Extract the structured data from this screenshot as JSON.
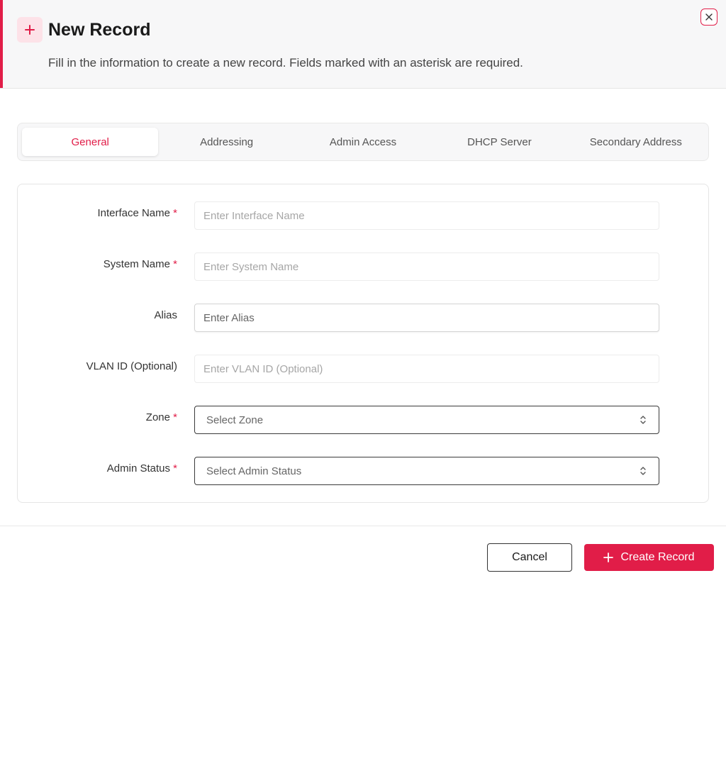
{
  "header": {
    "title": "New Record",
    "description": "Fill in the information to create a new record. Fields marked with an asterisk are required.",
    "icon": "plus-icon",
    "close_icon": "close-icon",
    "accent_color": "#e11d48"
  },
  "tabs": [
    {
      "label": "General",
      "active": true
    },
    {
      "label": "Addressing",
      "active": false
    },
    {
      "label": "Admin Access",
      "active": false
    },
    {
      "label": "DHCP Server",
      "active": false
    },
    {
      "label": "Secondary Address",
      "active": false
    }
  ],
  "form": {
    "interface_name": {
      "label": "Interface Name",
      "required_mark": "*",
      "placeholder": "Enter Interface Name",
      "value": ""
    },
    "system_name": {
      "label": "System Name",
      "required_mark": "*",
      "placeholder": "Enter System Name",
      "value": ""
    },
    "alias": {
      "label": "Alias",
      "placeholder": "Enter Alias",
      "value": ""
    },
    "vlan_id": {
      "label": "VLAN ID (Optional)",
      "placeholder": "Enter VLAN ID (Optional)",
      "value": ""
    },
    "zone": {
      "label": "Zone",
      "required_mark": "*",
      "selected": "Select Zone",
      "icon": "chevron-up-down-icon"
    },
    "admin_status": {
      "label": "Admin Status",
      "required_mark": "*",
      "selected": "Select Admin Status",
      "icon": "chevron-up-down-icon"
    }
  },
  "footer": {
    "cancel_label": "Cancel",
    "create_label": "Create Record",
    "create_icon": "plus-icon"
  }
}
